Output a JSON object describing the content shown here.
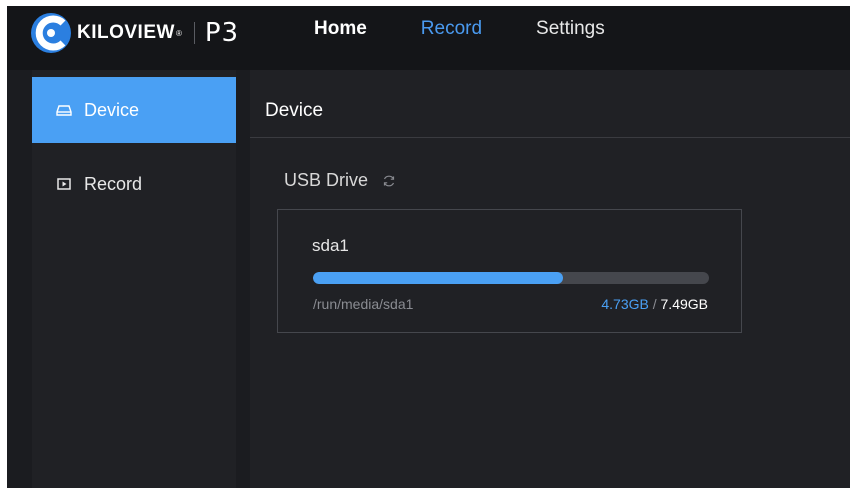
{
  "brand": {
    "name": "KILOVIEW",
    "registered_mark": "®",
    "model": "P3",
    "accent_color": "#4aa0f4"
  },
  "nav": {
    "items": [
      {
        "label": "Home"
      },
      {
        "label": "Record"
      },
      {
        "label": "Settings"
      }
    ]
  },
  "sidebar": {
    "items": [
      {
        "label": "Device",
        "icon": "drive-icon",
        "active": true
      },
      {
        "label": "Record",
        "icon": "record-icon",
        "active": false
      }
    ]
  },
  "main": {
    "title": "Device",
    "usb_section": {
      "label": "USB Drive",
      "refresh_icon": "refresh-icon"
    },
    "drive": {
      "name": "sda1",
      "path": "/run/media/sda1",
      "used": "4.73GB",
      "separator": "/",
      "total": "7.49GB",
      "usage_fraction": 0.6315
    }
  }
}
